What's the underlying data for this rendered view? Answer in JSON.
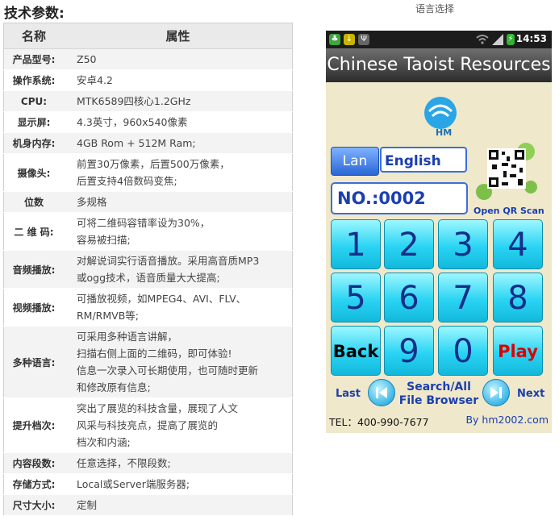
{
  "heading": "技术参数:",
  "caption": "语言选择",
  "specs": {
    "headers": [
      "名称",
      "属性"
    ],
    "rows": [
      {
        "k": "产品型号:",
        "v": "Z50"
      },
      {
        "k": "操作系统:",
        "v": "安卓4.2"
      },
      {
        "k": "CPU:",
        "v": "MTK6589四核心1.2GHz"
      },
      {
        "k": "显示屏:",
        "v": "4.3英寸，960x540像素"
      },
      {
        "k": "机身内存:",
        "v": "4GB Rom + 512M Ram;"
      },
      {
        "k": "摄像头:",
        "v": "前置30万像素，后置500万像素，\n后置支持4倍数码变焦;"
      },
      {
        "k": "位数",
        "v": "多规格"
      },
      {
        "k": "二 维 码:",
        "v": "可将二维码容错率设为30%，\n容易被扫描;"
      },
      {
        "k": "音频播放:",
        "v": "对解说词实行语音播放。采用高音质MP3\n或ogg技术，语音质量大大提高;"
      },
      {
        "k": "视频播放:",
        "v": "可播放视频，如MPEG4、AVI、FLV、\nRM/RMVB等;"
      },
      {
        "k": "多种语言:",
        "v": "可采用多种语言讲解，\n扫描右侧上面的二维码，即可体验!\n信息一次录入可长期使用，也可随时更新\n和修改原有信息;"
      },
      {
        "k": "提升档次:",
        "v": "突出了展览的科技含量，展现了人文\n风采与科技亮点，提高了展览的\n档次和内涵;"
      },
      {
        "k": "内容段数:",
        "v": "任意选择，不限段数;"
      },
      {
        "k": "存储方式:",
        "v": "Local或Server端服务器;"
      },
      {
        "k": "尺寸大小:",
        "v": "定制"
      }
    ]
  },
  "phone": {
    "time": "14:53",
    "title": "Chinese Taoist Resources",
    "logo_text": "HM",
    "lan_button": "Lan",
    "language_value": "English",
    "number_value": "NO.:0002",
    "qr_label": "Open QR Scan",
    "keys": [
      "1",
      "2",
      "3",
      "4",
      "5",
      "6",
      "7",
      "8",
      "Back",
      "9",
      "0",
      "Play"
    ],
    "last_label": "Last",
    "next_label": "Next",
    "browser_label_1": "Search/All",
    "browser_label_2": "File Browser",
    "tel": "TEL：400-990-7677",
    "by": "By hm2002.com",
    "colors": {
      "key": "#2ad4f3",
      "accent": "#1a3fb0",
      "play": "#e00000",
      "bg": "#efe8cb"
    }
  }
}
